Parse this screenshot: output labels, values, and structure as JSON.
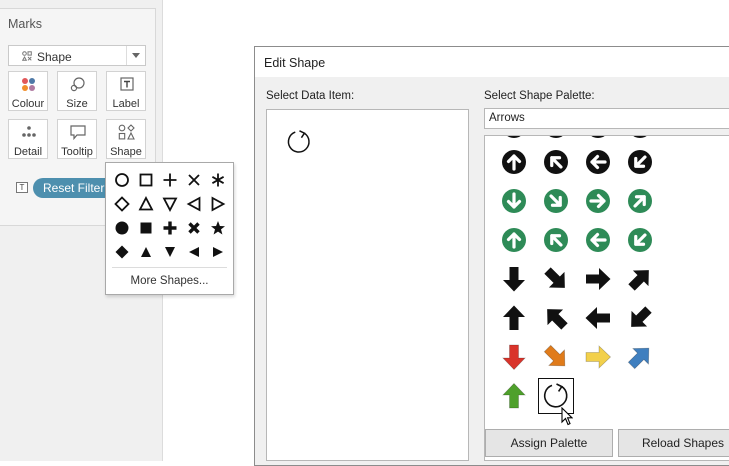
{
  "marks": {
    "title": "Marks",
    "mark_type": "Shape",
    "buttons": [
      {
        "label": "Colour",
        "icon": "colour-icon"
      },
      {
        "label": "Size",
        "icon": "size-icon"
      },
      {
        "label": "Label",
        "icon": "label-icon"
      },
      {
        "label": "Detail",
        "icon": "detail-icon"
      },
      {
        "label": "Tooltip",
        "icon": "tooltip-icon"
      },
      {
        "label": "Shape",
        "icon": "shape-icon"
      }
    ],
    "pill": {
      "field_type_icon": "T",
      "label": "Reset Filter"
    }
  },
  "shape_popup": {
    "shapes": [
      "circle-outline",
      "square-outline",
      "plus",
      "cross",
      "asterisk",
      "diamond-outline",
      "triangle-up-outline",
      "triangle-down-outline",
      "triangle-left-outline",
      "triangle-right-outline",
      "circle-filled",
      "square-filled",
      "plus-bold",
      "cross-bold",
      "star",
      "diamond-filled",
      "triangle-up-filled",
      "triangle-down-filled",
      "triangle-left-filled",
      "triangle-right-filled"
    ],
    "more_label": "More Shapes..."
  },
  "dialog": {
    "title": "Edit Shape",
    "data_item_label": "Select Data Item:",
    "palette_label": "Select Shape Palette:",
    "palette_selected": "Arrows",
    "data_item_shape": "refresh-arrow",
    "palette_rows": [
      [
        "arrow-up-black-circle",
        "arrow-upleft-black-circle",
        "arrow-left-black-circle",
        "arrow-downleft-black-circle"
      ],
      [
        "arrow-down-green-circle",
        "arrow-downright-green-circle",
        "arrow-right-green-circle",
        "arrow-upright-green-circle"
      ],
      [
        "arrow-up-green-circle",
        "arrow-upleft-green-circle",
        "arrow-left-green-circle",
        "arrow-downleft-green-circle"
      ],
      [
        "arrow-down-black",
        "arrow-downright-black",
        "arrow-right-black",
        "arrow-upright-black"
      ],
      [
        "arrow-up-black",
        "arrow-upleft-black",
        "arrow-left-black",
        "arrow-downleft-black"
      ],
      [
        "arrow-down-red",
        "arrow-downright-orange",
        "arrow-right-yellow",
        "arrow-upright-blue"
      ],
      [
        "arrow-up-green",
        "refresh-arrow-selected"
      ]
    ],
    "colors": {
      "black": "#111111",
      "green": "#2e8b57",
      "red": "#d9342b",
      "orange": "#e07b1a",
      "yellow": "#f2d04b",
      "blue": "#3f7fbf",
      "leaf_green": "#4ea02b"
    },
    "assign_button": "Assign Palette",
    "reload_button": "Reload Shapes"
  }
}
